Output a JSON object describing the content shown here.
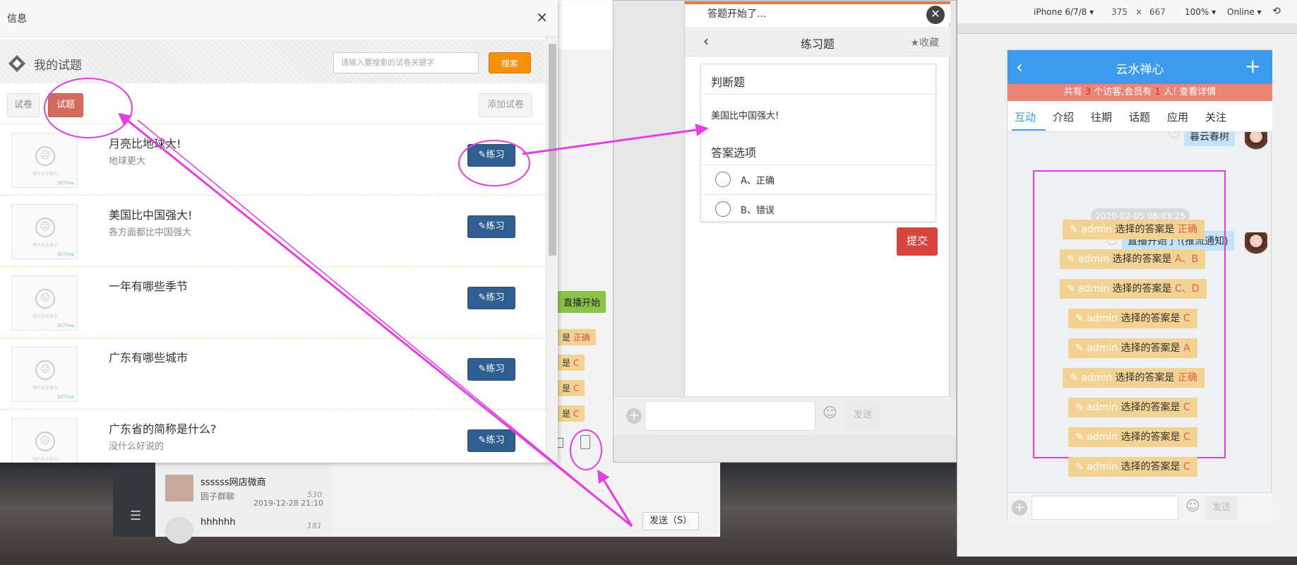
{
  "background_app": {
    "list_items": [
      {
        "name": "ssssss网店微商",
        "sub": "圆子群聊",
        "count": "530",
        "time": "2019-12-28 21:10"
      },
      {
        "name": "hhhhhh",
        "sub": "",
        "count": "181",
        "time": ""
      }
    ],
    "bubbles": [
      {
        "prefix": "是",
        "value": "正确"
      },
      {
        "prefix": "是",
        "value": "C"
      },
      {
        "prefix": "是",
        "value": "C"
      },
      {
        "prefix": "是",
        "value": "C"
      }
    ],
    "green_bubble": "直播开始",
    "send_label": "发送（S）",
    "menu_glyph": "☰"
  },
  "modal": {
    "title": "信息",
    "close": "×",
    "header_title": "我的试题",
    "search_placeholder": "请输入要搜索的试卷关键字",
    "search_button": "搜索",
    "tab_papers": "试卷",
    "tab_questions": "试题",
    "add_paper": "添加试卷",
    "practice_label": "练习",
    "thumb_caption": "图片无法显示",
    "thumb_tag": "DCTime",
    "questions": [
      {
        "title": "月亮比地球大!",
        "sub": "地球更大"
      },
      {
        "title": "美国比中国强大!",
        "sub": "各方面都比中国强大"
      },
      {
        "title": "一年有哪些季节",
        "sub": ""
      },
      {
        "title": "广东有哪些城市",
        "sub": ""
      },
      {
        "title": "广东省的简称是什么?",
        "sub": "没什么好说的"
      }
    ]
  },
  "practice": {
    "top_text": "答题开始了...",
    "nav_title": "练习题",
    "favorite": "收藏",
    "section_type": "判断题",
    "question": "美国比中国强大!",
    "options_title": "答案选项",
    "options": [
      "A、正确",
      "B、错误"
    ],
    "submit": "提交",
    "send": "发送"
  },
  "mobile": {
    "device": "iPhone 6/7/8",
    "width": "375",
    "times": "×",
    "height": "667",
    "zoom": "100%",
    "network": "Online",
    "title": "云水禅心",
    "notice_pre": "共有",
    "notice_visitors": "3",
    "notice_mid": "个访客,会员有",
    "notice_members": "1",
    "notice_post": "人! 查看详情",
    "tabs": [
      "互动",
      "介绍",
      "往期",
      "话题",
      "应用",
      "关注"
    ],
    "prev_msg": "暮云春树",
    "timestamp": "2020-02-05 08:03:25",
    "live_msg": "直播开始了!(推流通知)",
    "answer_user": "admin",
    "answer_text": "选择的答案是",
    "answers": [
      "正确",
      "A、B",
      "C、D",
      "C",
      "A",
      "正确",
      "C",
      "C",
      "C"
    ],
    "send": "发送"
  },
  "colors": {
    "annotation": "#e83be8",
    "primary_blue": "#3d9bef",
    "practice_btn": "#2f5f90",
    "search_btn": "#f5900d",
    "active_tab": "#d46a5e",
    "answer_bg": "#f2d393",
    "submit_red": "#d9443f"
  }
}
